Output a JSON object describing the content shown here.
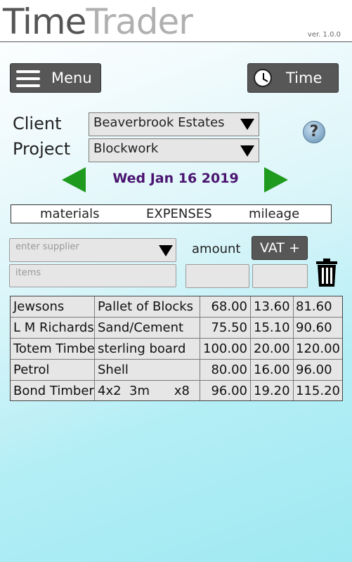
{
  "app": {
    "title_part1": "Time",
    "title_part2": "Trader",
    "version": "ver. 1.0.0"
  },
  "toolbar": {
    "menu_label": "Menu",
    "time_label": "Time"
  },
  "form": {
    "client_label": "Client",
    "client_value": "Beaverbrook Estates",
    "project_label": "Project",
    "project_value": "Blockwork",
    "help_label": "?"
  },
  "date_nav": {
    "date": "Wed Jan 16 2019"
  },
  "tabs": {
    "materials": "materials",
    "expenses": "EXPENSES",
    "mileage": "mileage"
  },
  "entry": {
    "supplier_placeholder": "enter supplier",
    "items_placeholder": "items",
    "amount_label": "amount",
    "vat_label": "VAT +"
  },
  "expenses": [
    {
      "supplier": "Jewsons",
      "item": "Pallet of Blocks",
      "qty": "",
      "amount": "68.00",
      "vat": "13.60",
      "total": "81.60"
    },
    {
      "supplier": "L M Richards",
      "item": "Sand/Cement",
      "qty": "",
      "amount": "75.50",
      "vat": "15.10",
      "total": "90.60"
    },
    {
      "supplier": "Totem Timber",
      "item": "sterling board",
      "qty": "",
      "amount": "100.00",
      "vat": "20.00",
      "total": "120.00"
    },
    {
      "supplier": "Petrol",
      "item": "Shell",
      "qty": "",
      "amount": "80.00",
      "vat": "16.00",
      "total": "96.00"
    },
    {
      "supplier": "Bond Timber",
      "item": "4x2  3m",
      "qty": "x8",
      "amount": "96.00",
      "vat": "19.20",
      "total": "115.20"
    }
  ],
  "colors": {
    "date": "#4a1470",
    "arrow": "#1e9a1e",
    "button": "#575757"
  }
}
